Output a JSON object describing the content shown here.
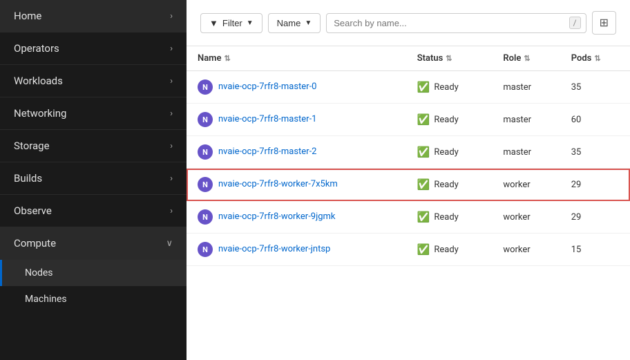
{
  "sidebar": {
    "items": [
      {
        "id": "home",
        "label": "Home",
        "hasChevron": true,
        "expanded": false
      },
      {
        "id": "operators",
        "label": "Operators",
        "hasChevron": true,
        "expanded": false
      },
      {
        "id": "workloads",
        "label": "Workloads",
        "hasChevron": true,
        "expanded": false
      },
      {
        "id": "networking",
        "label": "Networking",
        "hasChevron": true,
        "expanded": false
      },
      {
        "id": "storage",
        "label": "Storage",
        "hasChevron": true,
        "expanded": false
      },
      {
        "id": "builds",
        "label": "Builds",
        "hasChevron": true,
        "expanded": false
      },
      {
        "id": "observe",
        "label": "Observe",
        "hasChevron": true,
        "expanded": false
      },
      {
        "id": "compute",
        "label": "Compute",
        "hasChevron": false,
        "expanded": true
      }
    ],
    "sub_items": [
      {
        "id": "nodes",
        "label": "Nodes",
        "active": true
      },
      {
        "id": "machines",
        "label": "Machines",
        "active": false
      }
    ]
  },
  "toolbar": {
    "filter_label": "Filter",
    "name_label": "Name",
    "search_placeholder": "Search by name...",
    "search_shortcut": "/",
    "columns_icon": "⊞"
  },
  "table": {
    "columns": [
      {
        "id": "name",
        "label": "Name"
      },
      {
        "id": "status",
        "label": "Status"
      },
      {
        "id": "role",
        "label": "Role"
      },
      {
        "id": "pods",
        "label": "Pods"
      }
    ],
    "rows": [
      {
        "id": "row-0",
        "name": "nvaie-ocp-7rfr8-master-0",
        "status": "Ready",
        "role": "master",
        "pods": "35",
        "highlighted": false
      },
      {
        "id": "row-1",
        "name": "nvaie-ocp-7rfr8-master-1",
        "status": "Ready",
        "role": "master",
        "pods": "60",
        "highlighted": false
      },
      {
        "id": "row-2",
        "name": "nvaie-ocp-7rfr8-master-2",
        "status": "Ready",
        "role": "master",
        "pods": "35",
        "highlighted": false
      },
      {
        "id": "row-3",
        "name": "nvaie-ocp-7rfr8-worker-7x5km",
        "status": "Ready",
        "role": "worker",
        "pods": "29",
        "highlighted": true
      },
      {
        "id": "row-4",
        "name": "nvaie-ocp-7rfr8-worker-9jgmk",
        "status": "Ready",
        "role": "worker",
        "pods": "29",
        "highlighted": false
      },
      {
        "id": "row-5",
        "name": "nvaie-ocp-7rfr8-worker-jntsp",
        "status": "Ready",
        "role": "worker",
        "pods": "15",
        "highlighted": false
      }
    ]
  }
}
